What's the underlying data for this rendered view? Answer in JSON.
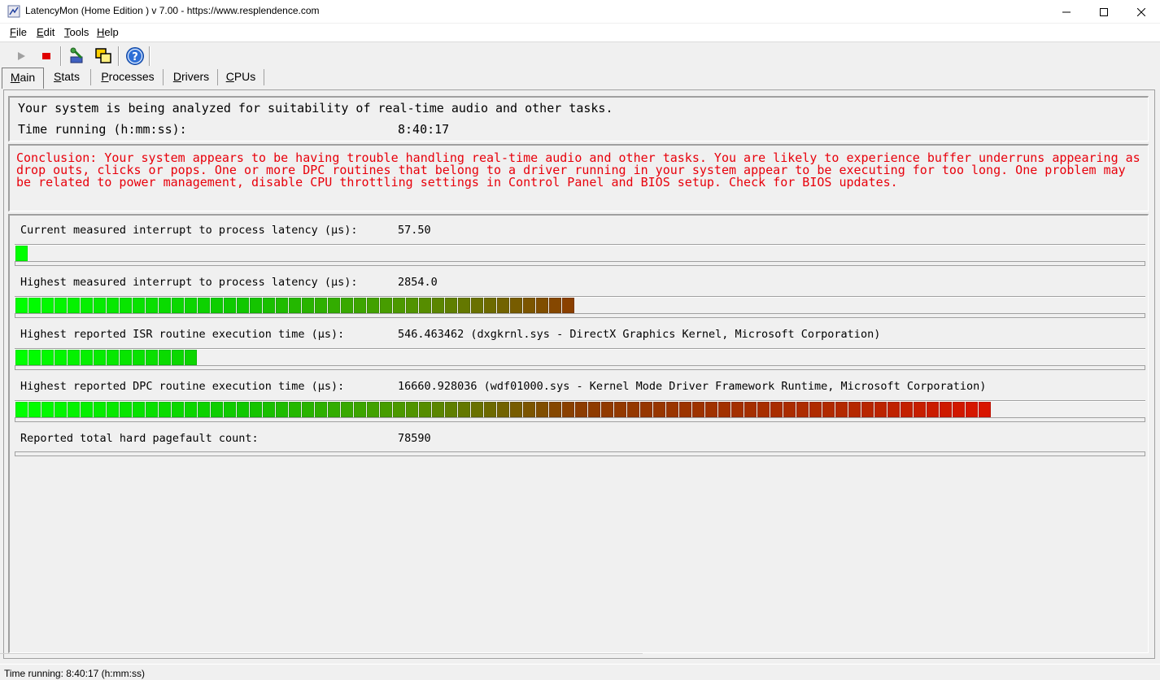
{
  "window": {
    "title": "LatencyMon  (Home Edition )  v 7.00 - https://www.resplendence.com"
  },
  "menu": {
    "items": [
      {
        "key": "F",
        "rest": "ile"
      },
      {
        "key": "E",
        "rest": "dit"
      },
      {
        "key": "T",
        "rest": "ools"
      },
      {
        "key": "H",
        "rest": "elp"
      }
    ]
  },
  "toolbar": {
    "icons": [
      "play-icon",
      "stop-icon",
      "settings-icon",
      "windows-icon",
      "help-icon"
    ]
  },
  "tabs": [
    {
      "key": "M",
      "rest": "ain",
      "active": true
    },
    {
      "key": "S",
      "rest": "tats",
      "active": false
    },
    {
      "key": "P",
      "rest": "rocesses",
      "active": false
    },
    {
      "key": "D",
      "rest": "rivers",
      "active": false
    },
    {
      "key": "C",
      "rest": "PUs",
      "active": false
    }
  ],
  "status": {
    "analyzing": "Your system is being analyzed for suitability of real-time audio and other tasks.",
    "time_label": "Time running (h:mm:ss):",
    "time_value": "8:40:17"
  },
  "conclusion": "Conclusion: Your system appears to be having trouble handling real-time audio and other tasks. You are likely to experience buffer underruns appearing as drop outs, clicks or pops. One or more DPC routines that belong to a driver running in your system appear to be executing for too long. One problem may be related to power management, disable CPU throttling settings in Control Panel and BIOS setup. Check for BIOS updates.",
  "metrics": [
    {
      "label": "Current measured interrupt to process latency (µs):",
      "value": "57.50",
      "level_fraction": 0.011
    },
    {
      "label": "Highest measured interrupt to process latency (µs):",
      "value": "2854.0",
      "level_fraction": 0.505
    },
    {
      "label": "Highest reported ISR routine execution time (µs):",
      "value": "546.463462  (dxgkrnl.sys - DirectX Graphics Kernel, Microsoft Corporation)",
      "level_fraction": 0.161
    },
    {
      "label": "Highest reported DPC routine execution time (µs):",
      "value": "16660.928036  (wdf01000.sys - Kernel Mode Driver Framework Runtime, Microsoft Corporation)",
      "level_fraction": 0.874
    },
    {
      "label": "Reported total hard pagefault count:",
      "value": "78590",
      "level_fraction": 0
    }
  ],
  "statusbar": {
    "text": "Time running: 8:40:17  (h:mm:ss)"
  },
  "colors": {
    "conclusion_text": "#e8000b",
    "bar_start": "#00ff00",
    "bar_end": "#ff0000"
  }
}
